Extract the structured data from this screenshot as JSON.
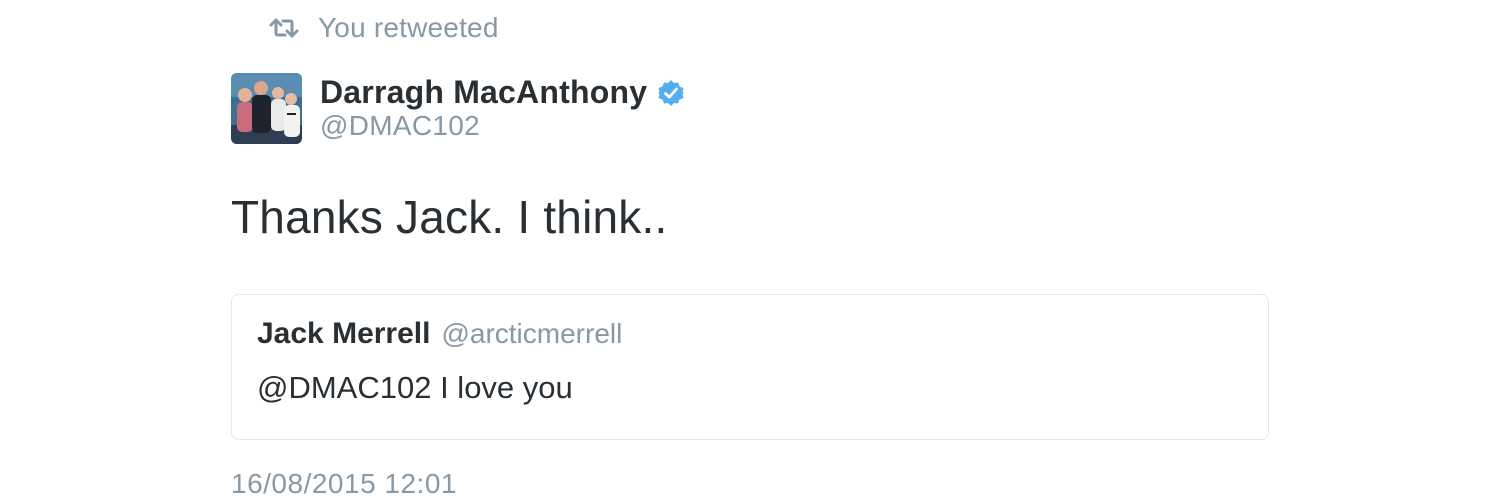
{
  "context": {
    "text": "You retweeted",
    "icon": "retweet-icon"
  },
  "tweet": {
    "author": {
      "name": "Darragh MacAnthony",
      "handle": "@DMAC102",
      "verified": true,
      "verified_icon": "verified-badge-icon"
    },
    "text": "Thanks Jack. I think..",
    "timestamp": "16/08/2015 12:01"
  },
  "quoted_tweet": {
    "name": "Jack Merrell",
    "handle": "@arcticmerrell",
    "text": "@DMAC102 I love you"
  },
  "colors": {
    "text_primary": "#292f33",
    "text_secondary": "#8899a6",
    "verified_blue": "#55acee",
    "card_border": "#e1e8ed"
  }
}
